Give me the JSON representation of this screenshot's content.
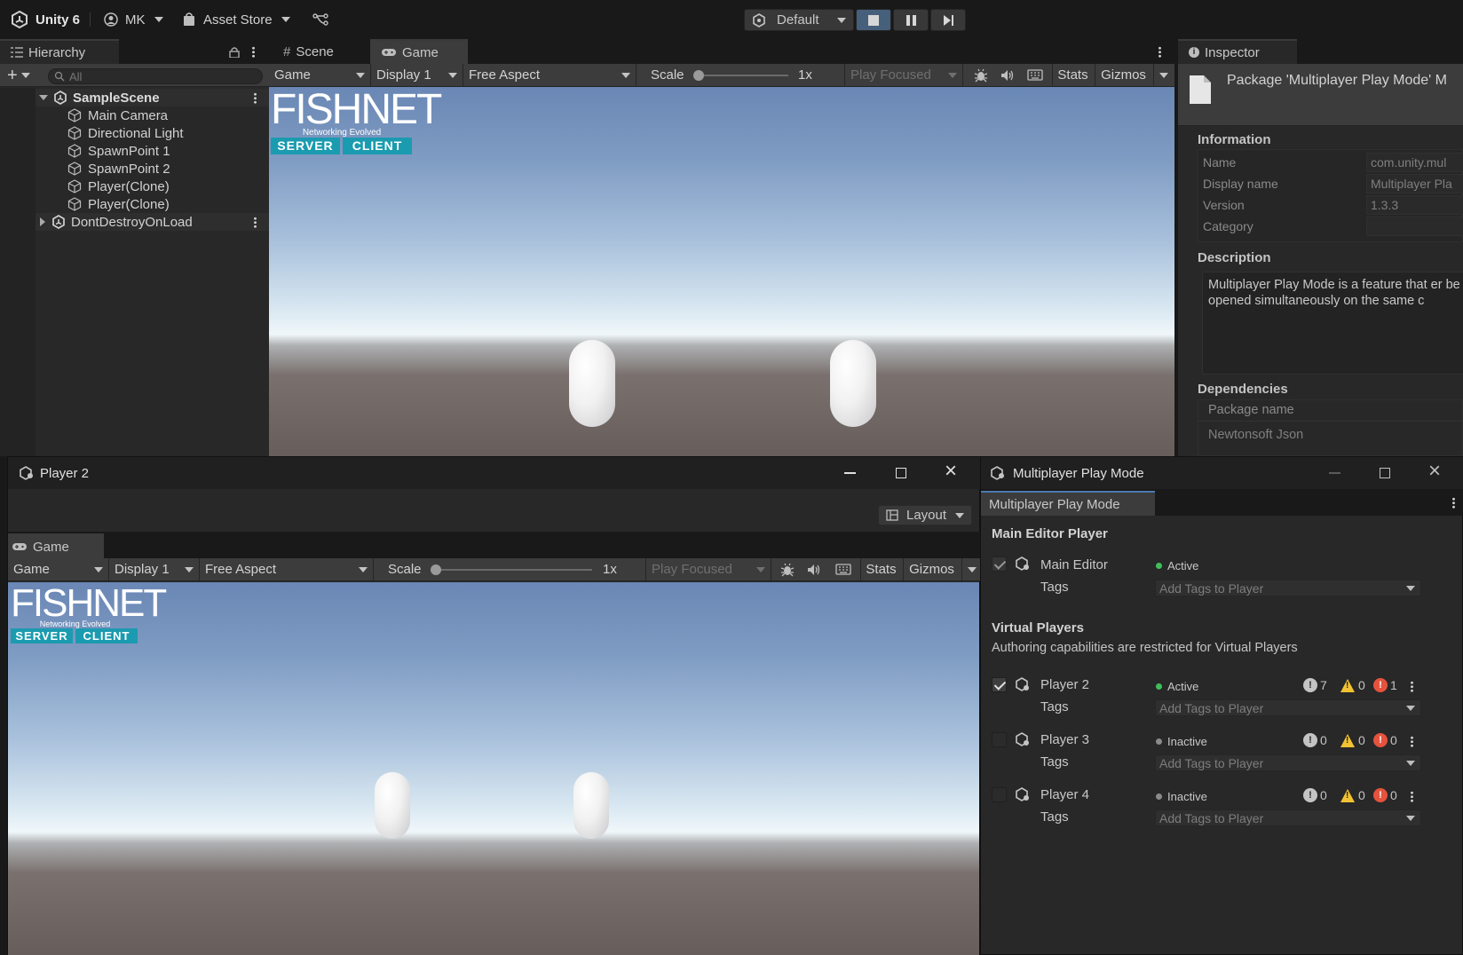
{
  "toolbar": {
    "app_name": "Unity 6",
    "account": "MK",
    "asset_store": "Asset Store",
    "layout": "Default"
  },
  "hierarchy": {
    "tab": "Hierarchy",
    "search_placeholder": "All",
    "scene": "SampleScene",
    "objects": [
      "Main Camera",
      "Directional Light",
      "SpawnPoint 1",
      "SpawnPoint 2",
      "Player(Clone)",
      "Player(Clone)"
    ],
    "dont_destroy": "DontDestroyOnLoad"
  },
  "scene_tabs": {
    "scene": "Scene",
    "game": "Game"
  },
  "game_toolbar": {
    "view": "Game",
    "display": "Display 1",
    "aspect": "Free Aspect",
    "scale_label": "Scale",
    "scale_value": "1x",
    "play_focused": "Play Focused",
    "stats": "Stats",
    "gizmos": "Gizmos"
  },
  "logo": {
    "title": "FISHNET",
    "subtitle": "Networking Evolved",
    "server": "SERVER",
    "client": "CLIENT"
  },
  "inspector": {
    "tab": "Inspector",
    "title": "Package 'Multiplayer Play Mode' M",
    "info_header": "Information",
    "rows": [
      {
        "label": "Name",
        "value": "com.unity.mul"
      },
      {
        "label": "Display name",
        "value": "Multiplayer Pla"
      },
      {
        "label": "Version",
        "value": "1.3.3"
      },
      {
        "label": "Category",
        "value": ""
      }
    ],
    "desc_header": "Description",
    "description": "Multiplayer Play Mode is a feature that er be opened simultaneously on the same c",
    "deps_header": "Dependencies",
    "deps_col": "Package name",
    "dep": "Newtonsoft Json"
  },
  "player2_window": {
    "title": "Player 2",
    "layout": "Layout",
    "tab": "Game"
  },
  "mppm": {
    "window_title": "Multiplayer Play Mode",
    "tab": "Multiplayer Play Mode",
    "main_header": "Main Editor Player",
    "main_name": "Main Editor",
    "main_status": "Active",
    "tags_label": "Tags",
    "tags_placeholder": "Add Tags to Player",
    "virtual_header": "Virtual Players",
    "virtual_note": "Authoring capabilities are restricted for Virtual Players",
    "players": [
      {
        "name": "Player 2",
        "status": "Active",
        "info": "7",
        "warn": "0",
        "err": "1"
      },
      {
        "name": "Player 3",
        "status": "Inactive",
        "info": "0",
        "warn": "0",
        "err": "0"
      },
      {
        "name": "Player 4",
        "status": "Inactive",
        "info": "0",
        "warn": "0",
        "err": "0"
      }
    ],
    "colors": {
      "active": "#3fbf5a",
      "inactive": "#8a8a8a",
      "error": "#e5533d",
      "warning": "#f1c232"
    }
  }
}
